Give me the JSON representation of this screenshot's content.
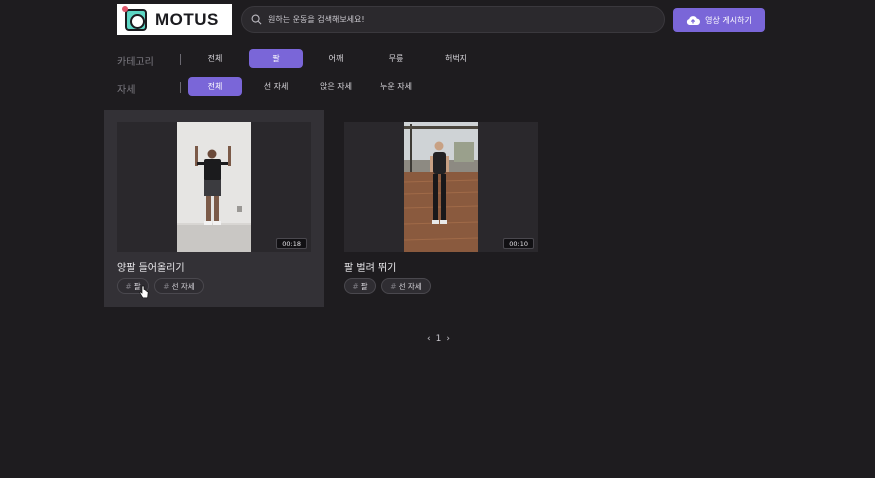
{
  "header": {
    "logo_text": "MOTUS",
    "search_placeholder": "원하는 운동을 검색해보세요!",
    "upload_label": "영상 게시하기"
  },
  "filters": {
    "category": {
      "label": "카테고리",
      "options": [
        "전체",
        "팔",
        "어깨",
        "무릎",
        "허벅지"
      ],
      "selected": "팔"
    },
    "posture": {
      "label": "자세",
      "options": [
        "전체",
        "선 자세",
        "앉은 자세",
        "누운 자세"
      ],
      "selected": "전체"
    }
  },
  "videos": [
    {
      "title": "양팔 들어올리기",
      "duration": "00:18",
      "tags": [
        "팔",
        "선 자세"
      ]
    },
    {
      "title": "팔 벌려 뛰기",
      "duration": "00:10",
      "tags": [
        "팔",
        "선 자세"
      ]
    }
  ],
  "pagination": {
    "prev": "‹",
    "current": "1",
    "next": "›"
  },
  "colors": {
    "accent": "#7a66d8",
    "background": "#1e1c1f"
  }
}
